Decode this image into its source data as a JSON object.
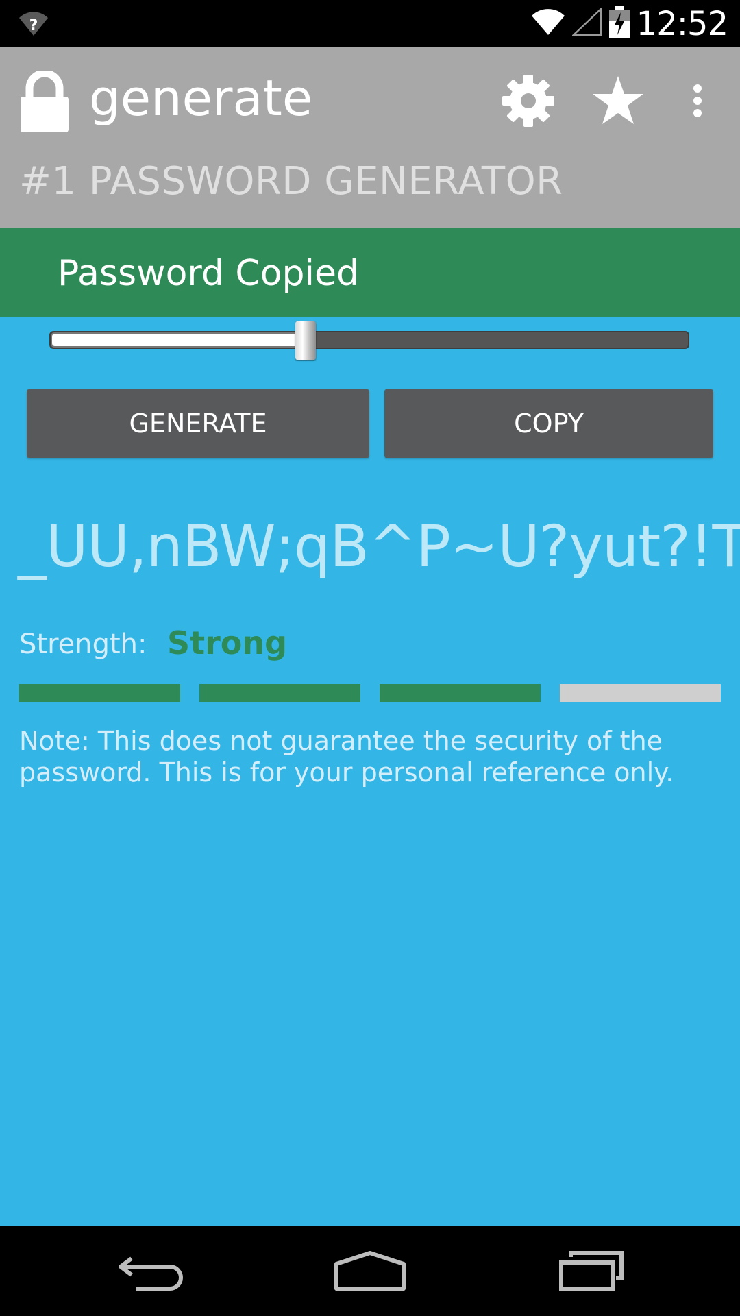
{
  "status_bar": {
    "time": "12:52",
    "icons": [
      "wifi-unknown-icon",
      "wifi-icon",
      "signal-icon",
      "battery-charging-icon"
    ]
  },
  "app_bar": {
    "title": "generate",
    "subtitle": "#1 PASSWORD GENERATOR",
    "icons": [
      "lock-icon",
      "gear-icon",
      "star-icon",
      "overflow-menu-icon"
    ]
  },
  "toast": {
    "message": "Password Copied"
  },
  "length_slider": {
    "value_fraction": 0.4
  },
  "buttons": {
    "generate_label": "GENERATE",
    "copy_label": "COPY"
  },
  "password": {
    "value": "_UU,nBW;qB^P~U?yut?!Tzf"
  },
  "strength": {
    "label": "Strength:",
    "value": "Strong",
    "filled_segments": 3,
    "total_segments": 4
  },
  "note": {
    "text": "Note: This does not guarantee the security of the password. This is for your personal reference only."
  },
  "nav_bar": {
    "icons": [
      "back-icon",
      "home-icon",
      "recents-icon"
    ]
  },
  "colors": {
    "background": "#33b5e5",
    "app_bar": "#a8a8a8",
    "toast": "#2e8b57",
    "button": "#58595b",
    "strength_filled": "#2e8b57",
    "strength_empty": "#cfcfcf"
  }
}
